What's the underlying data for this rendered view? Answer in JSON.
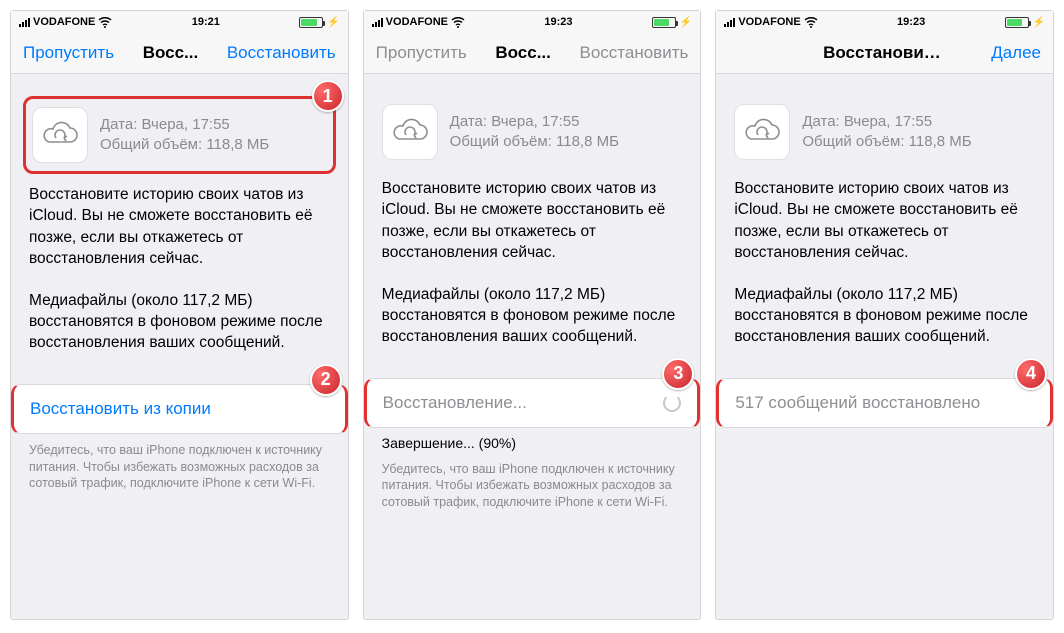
{
  "colors": {
    "tint": "#007aff",
    "highlight": "#e03131"
  },
  "screens": [
    {
      "status": {
        "carrier": "VODAFONE",
        "wifi": true,
        "time": "19:21",
        "charging": true
      },
      "nav": {
        "left": "Пропустить",
        "title": "Восс...",
        "right": "Восстановить",
        "left_enabled": true,
        "right_enabled": true,
        "title_full": ""
      },
      "backup": {
        "date_label": "Дата: Вчера, 17:55",
        "size_label": "Общий объём: 118,8 МБ",
        "highlighted": true,
        "badge": "1"
      },
      "para1": "Восстановите историю своих чатов из iCloud. Вы не сможете восстановить её позже, если вы откажетесь от восстановления сейчас.",
      "para2": "Медиафайлы (около 117,2 МБ) восстановятся в фоновом режиме после восстановления ваших сообщений.",
      "action": {
        "label": "Восстановить из копии",
        "style": "blue",
        "interactable": true,
        "spinner": false,
        "badge": "2",
        "subtext": "Убедитесь, что ваш iPhone подключен к источнику питания. Чтобы избежать возможных расходов за сотовый трафик, подключите iPhone к сети Wi-Fi.",
        "progress": ""
      }
    },
    {
      "status": {
        "carrier": "VODAFONE",
        "wifi": true,
        "time": "19:23",
        "charging": true
      },
      "nav": {
        "left": "Пропустить",
        "title": "Восс...",
        "right": "Восстановить",
        "left_enabled": false,
        "right_enabled": false,
        "title_full": ""
      },
      "backup": {
        "date_label": "Дата: Вчера, 17:55",
        "size_label": "Общий объём: 118,8 МБ",
        "highlighted": false,
        "badge": ""
      },
      "para1": "Восстановите историю своих чатов из iCloud. Вы не сможете восстановить её позже, если вы откажетесь от восстановления сейчас.",
      "para2": "Медиафайлы (около 117,2 МБ) восстановятся в фоновом режиме после восстановления ваших сообщений.",
      "action": {
        "label": "Восстановление...",
        "style": "gray",
        "interactable": false,
        "spinner": true,
        "badge": "3",
        "subtext": "Убедитесь, что ваш iPhone подключен к источнику питания. Чтобы избежать возможных расходов за сотовый трафик, подключите iPhone к сети Wi-Fi.",
        "progress": "Завершение... (90%)"
      }
    },
    {
      "status": {
        "carrier": "VODAFONE",
        "wifi": true,
        "time": "19:23",
        "charging": true
      },
      "nav": {
        "left": "",
        "title": "",
        "right": "Далее",
        "left_enabled": false,
        "right_enabled": true,
        "title_full": "Восстановить из iCloud"
      },
      "backup": {
        "date_label": "Дата: Вчера, 17:55",
        "size_label": "Общий объём: 118,8 МБ",
        "highlighted": false,
        "badge": ""
      },
      "para1": "Восстановите историю своих чатов из iCloud. Вы не сможете восстановить её позже, если вы откажетесь от восстановления сейчас.",
      "para2": "Медиафайлы (около 117,2 МБ) восстановятся в фоновом режиме после восстановления ваших сообщений.",
      "action": {
        "label": "517 сообщений восстановлено",
        "style": "gray",
        "interactable": false,
        "spinner": false,
        "badge": "4",
        "subtext": "",
        "progress": ""
      }
    }
  ]
}
